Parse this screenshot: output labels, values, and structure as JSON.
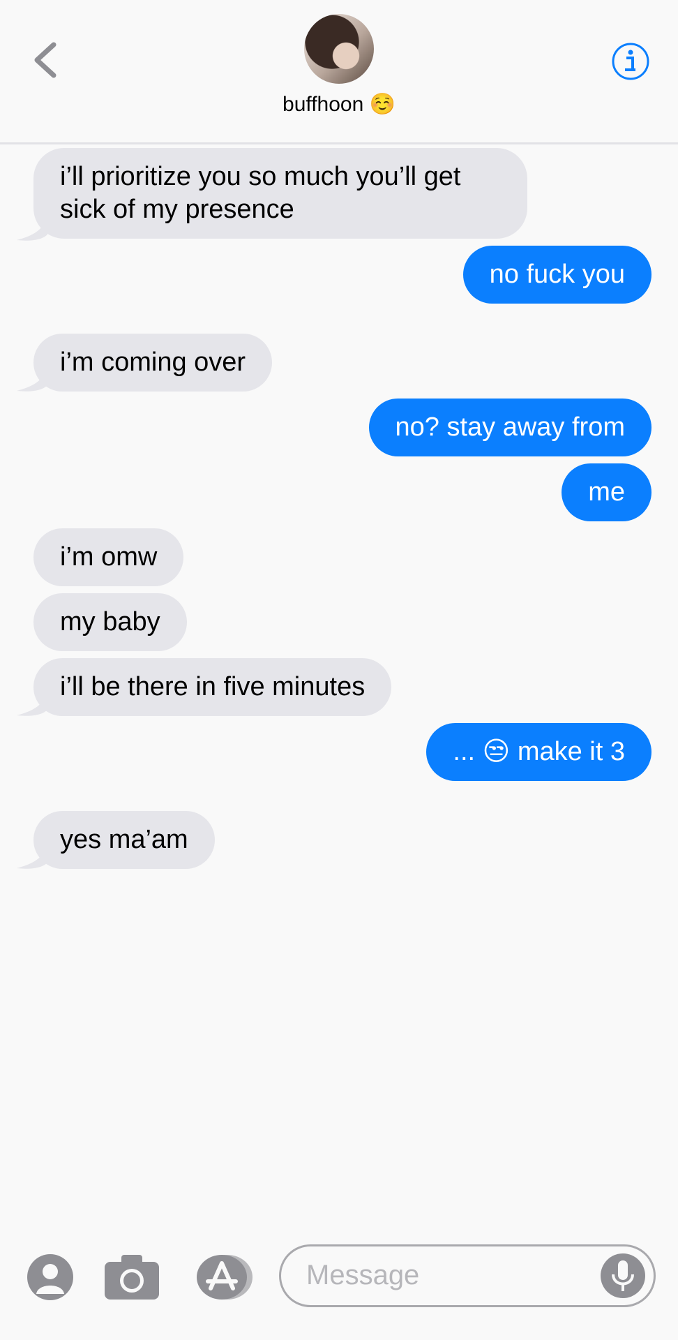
{
  "header": {
    "contact_name": "buffhoon ☺️",
    "back_icon": "chevron-left-icon",
    "info_icon": "info-icon"
  },
  "messages": [
    {
      "from": "them",
      "text": "i’ll prioritize you so much you’ll get sick of my presence"
    },
    {
      "from": "me",
      "text": "no fuck you"
    },
    {
      "from": "them",
      "text": "i’m coming over"
    },
    {
      "from": "me",
      "text": "no? stay away from"
    },
    {
      "from": "me",
      "text": "me"
    },
    {
      "from": "them",
      "text": "i’m omw"
    },
    {
      "from": "them",
      "text": "my baby"
    },
    {
      "from": "them",
      "text": "i’ll be there in five minutes"
    },
    {
      "from": "me",
      "text": "... 😒 make it 3"
    },
    {
      "from": "them",
      "text": "yes ma’am"
    }
  ],
  "compose": {
    "placeholder": "Message",
    "tools": [
      "contact-icon",
      "camera-icon",
      "app-store-icon",
      "microphone-icon"
    ]
  },
  "colors": {
    "outgoing_bubble": "#0b7ffe",
    "incoming_bubble": "#e5e5ea",
    "accent": "#0b7ffe"
  }
}
